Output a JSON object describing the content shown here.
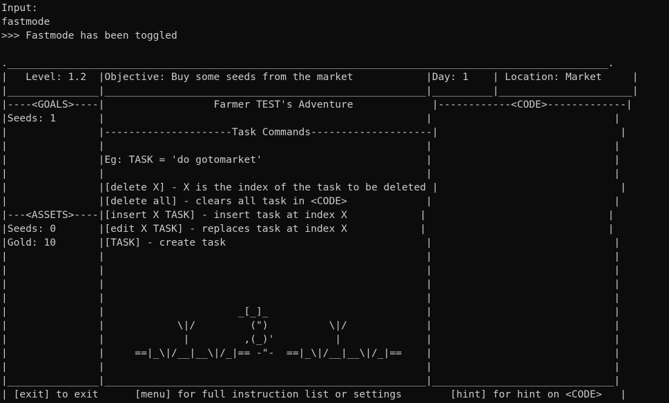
{
  "window": {
    "background": "#0c0c0c",
    "foreground": "#cccccc"
  },
  "console": {
    "lines": [
      "Input:",
      "fastmode",
      ">>> Fastmode has been toggled",
      "",
      ".___________________________________________________________________________________________________.",
      "|   Level: 1.2  |Objective: Buy some seeds from the market            |Day: 1    | Location: Market     |",
      "|_______________|_____________________________________________________|__________|______________________|",
      "|----<GOALS>----|                  Farmer TEST's Adventure             |------------<CODE>-------------|",
      "|Seeds: 1       |                                                     |                              |",
      "|               |---------------------Task Commands--------------------|                              |",
      "|               |                                                     |                              |",
      "|               |Eg: TASK = 'do gotomarket'                           |                              |",
      "|               |                                                     |                              |",
      "|               |[delete X] - X is the index of the task to be deleted |                              |",
      "|               |[delete all] - clears all task in <CODE>             |                              |",
      "|---<ASSETS>----|[insert X TASK] - insert task at index X            |                              |",
      "|Seeds: 0       |[edit X TASK] - replaces task at index X            |                              |",
      "|Gold: 10       |[TASK] - create task                                 |                              |",
      "|               |                                                     |                              |",
      "|               |                                                     |                              |",
      "|               |                                                     |                              |",
      "|               |                                                     |                              |",
      "|               |                      _[_]_                          |                              |",
      "|               |            \\|/         (\")          \\|/             |                              |",
      "|               |             |         ,(_)'          |              |                              |",
      "|               |     ==|_\\|/__|__\\|/_|== -\"-  ==|_\\|/__|__\\|/_|==    |                              |",
      "|               |                                                     |                              |",
      "|_______________|_____________________________________________________|______________________________|",
      "| [exit] to exit      [menu] for full instruction list or settings        [hint] for hint on <CODE>   |"
    ]
  }
}
